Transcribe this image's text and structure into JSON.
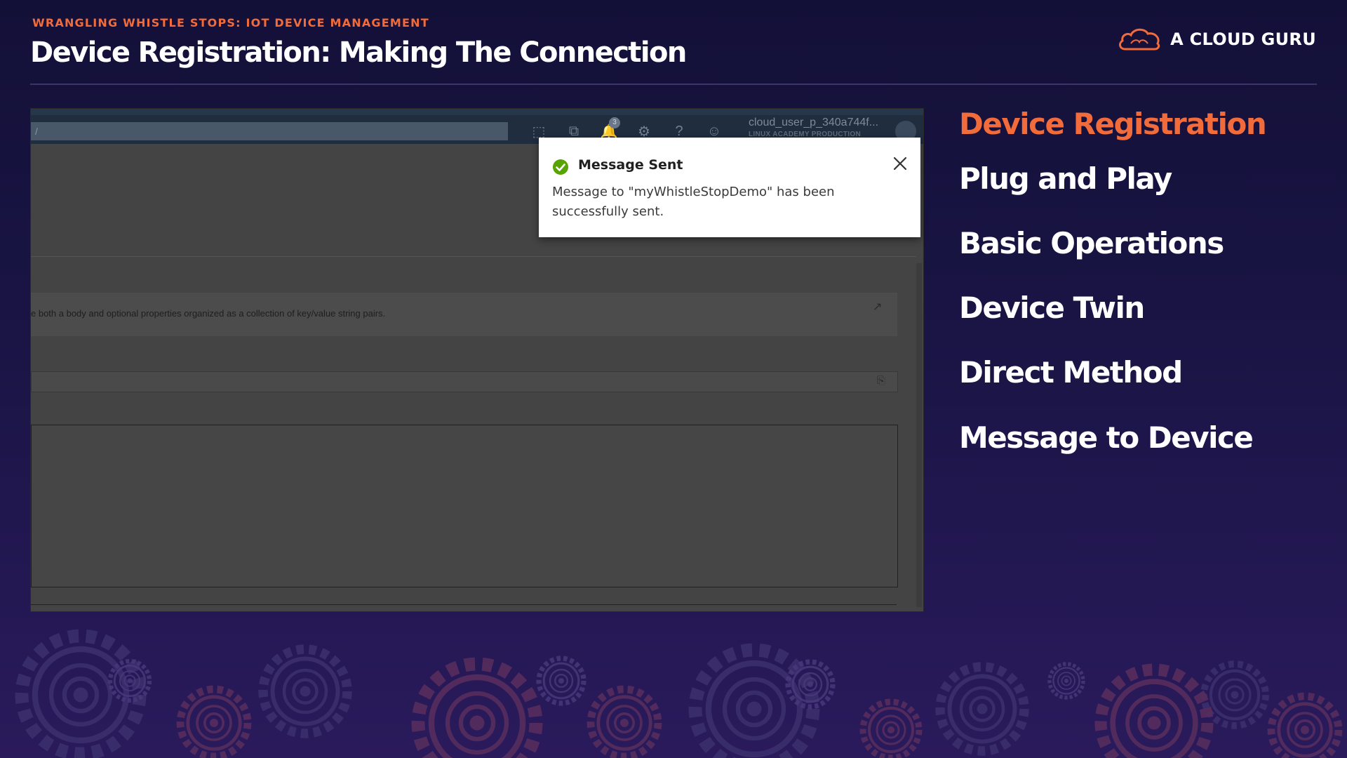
{
  "header": {
    "subtitle": "WRANGLING WHISTLE STOPS: IOT DEVICE MANAGEMENT",
    "title": "Device Registration: Making The Connection",
    "brand": "A CLOUD GURU"
  },
  "screenshot": {
    "portal": {
      "user_name": "cloud_user_p_340a744f...",
      "user_sub": "LINUX ACADEMY PRODUCTION",
      "notification_count": "3",
      "icons": [
        "cloud-shell-icon",
        "directory-icon",
        "bell-icon",
        "gear-icon",
        "help-icon",
        "feedback-icon"
      ]
    },
    "info_text": "e both a body and optional properties organized as a collection of key/value string pairs.",
    "toast": {
      "title": "Message Sent",
      "body": "Message to \"myWhistleStopDemo\" has been successfully sent.",
      "status_color": "#57a300"
    }
  },
  "topics": [
    {
      "label": "Device Registration",
      "active": true
    },
    {
      "label": "Plug and Play",
      "active": false
    },
    {
      "label": "Basic Operations",
      "active": false
    },
    {
      "label": "Device Twin",
      "active": false
    },
    {
      "label": "Direct Method",
      "active": false
    },
    {
      "label": "Message to Device",
      "active": false
    }
  ],
  "colors": {
    "accent": "#f26b3a",
    "background": "#1a1545"
  }
}
